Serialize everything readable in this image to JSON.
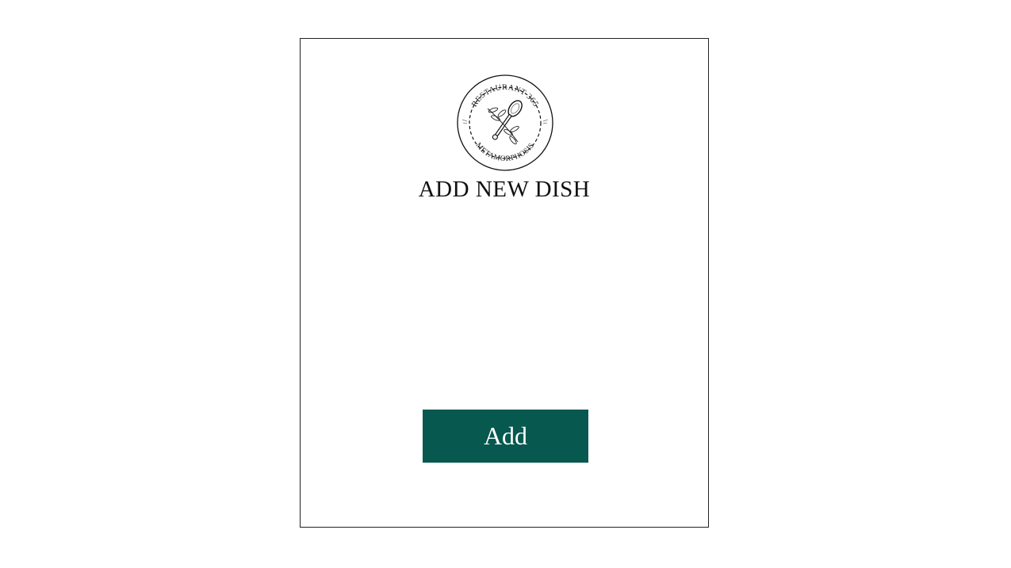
{
  "form": {
    "title": "ADD NEW DISH",
    "submit_label": "Add"
  },
  "logo": {
    "icon": "restaurant-seal-spoon-icon",
    "text_top": "RESTAURANT 365",
    "text_bottom": "METAMORPHOSIS"
  },
  "colors": {
    "accent": "#07584f",
    "border": "#222222",
    "text": "#111111"
  }
}
